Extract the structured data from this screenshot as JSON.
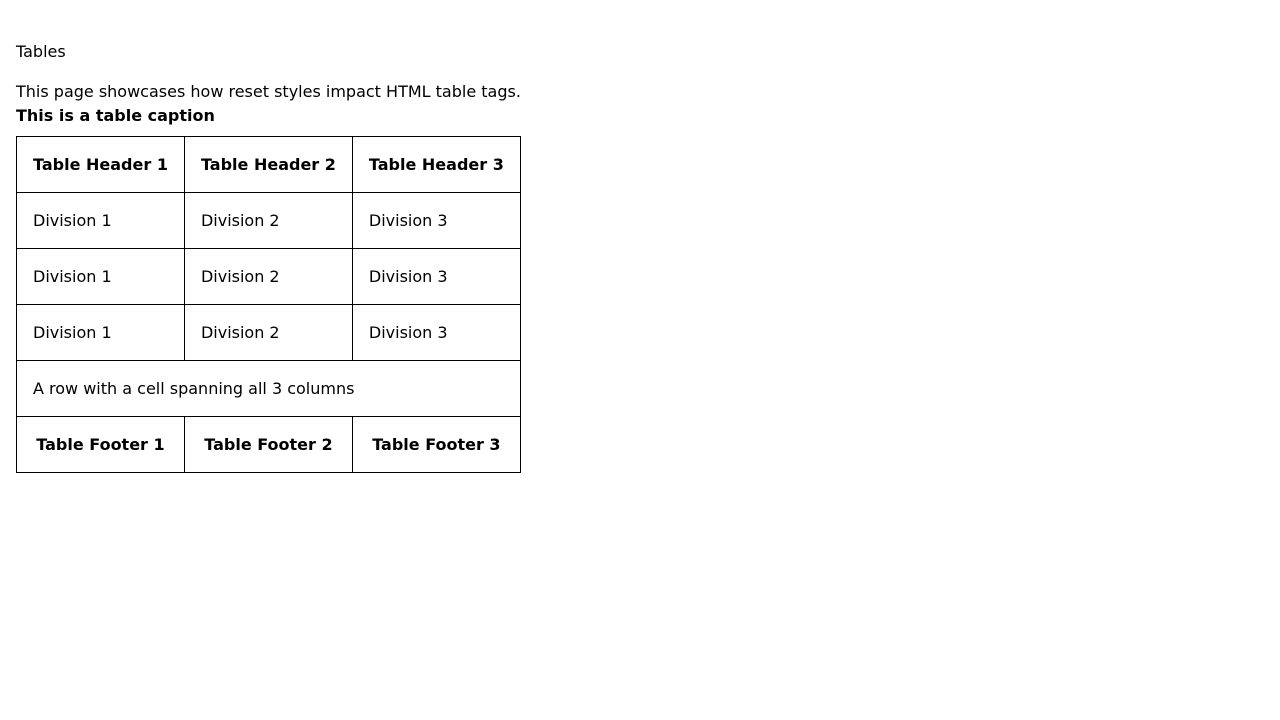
{
  "page": {
    "title": "Tables",
    "intro": "This page showcases how reset styles impact HTML table tags."
  },
  "table": {
    "caption": "This is a table caption",
    "headers": [
      "Table Header 1",
      "Table Header 2",
      "Table Header 3"
    ],
    "rows": [
      [
        "Division 1",
        "Division 2",
        "Division 3"
      ],
      [
        "Division 1",
        "Division 2",
        "Division 3"
      ],
      [
        "Division 1",
        "Division 2",
        "Division 3"
      ]
    ],
    "span_row": "A row with a cell spanning all 3 columns",
    "footers": [
      "Table Footer 1",
      "Table Footer 2",
      "Table Footer 3"
    ]
  }
}
